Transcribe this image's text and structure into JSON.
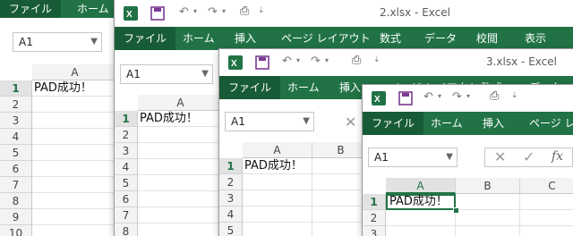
{
  "colors": {
    "excel_green": "#217346",
    "excel_dark_green": "#185c37"
  },
  "icons": [
    "excel-icon",
    "save-icon",
    "undo-icon",
    "redo-icon",
    "preview-icon",
    "customize-icon",
    "dropdown-arrow-icon",
    "cancel-icon",
    "enter-icon",
    "fx-icon"
  ],
  "windows": [
    {
      "ribbon": {
        "tabs": [
          "ファイル",
          "ホーム"
        ]
      },
      "name_box": "A1",
      "columns": [
        "A"
      ],
      "rows": [
        "1",
        "2",
        "3",
        "4",
        "5",
        "6",
        "7",
        "8",
        "9",
        "10"
      ],
      "cell_a1": "PAD成功！"
    },
    {
      "title": "2.xlsx  -  Excel",
      "ribbon": {
        "tabs": [
          "ファイル",
          "ホーム",
          "挿入",
          "ページ レイアウト",
          "数式",
          "データ",
          "校閲",
          "表示"
        ]
      },
      "name_box": "A1",
      "columns": [
        "A"
      ],
      "rows": [
        "1",
        "2",
        "3",
        "4",
        "5",
        "6",
        "7",
        "8"
      ],
      "cell_a1": "PAD成功！"
    },
    {
      "title": "3.xlsx  -  Excel",
      "ribbon": {
        "tabs": [
          "ファイル",
          "ホーム",
          "挿入",
          "ページ レイアウト",
          "数式",
          "データ"
        ]
      },
      "name_box": "A1",
      "columns": [
        "A",
        "B"
      ],
      "rows": [
        "1",
        "2",
        "3",
        "4",
        "5"
      ],
      "cell_a1": "PAD成功！"
    },
    {
      "ribbon": {
        "tabs": [
          "ファイル",
          "ホーム",
          "挿入",
          "ページ レイ"
        ]
      },
      "name_box": "A1",
      "fx_label": "fx",
      "columns": [
        "A",
        "B",
        "C"
      ],
      "rows": [
        "1",
        "2",
        "3"
      ],
      "cell_a1": "PAD成功！"
    }
  ]
}
